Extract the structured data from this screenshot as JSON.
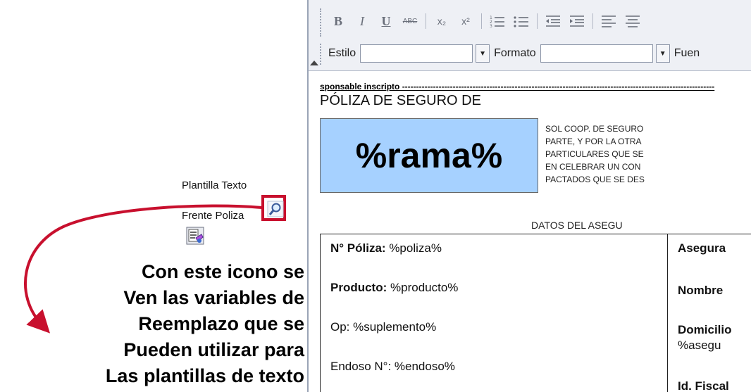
{
  "left_panel": {
    "plantilla_label": "Plantilla Texto",
    "frente_label": "Frente Poliza",
    "callout_lines": [
      "Con este icono se",
      "Ven las variables de",
      "Reemplazo que se",
      "Pueden utilizar para",
      "Las plantillas de texto"
    ]
  },
  "toolbar": {
    "bold": "B",
    "italic": "I",
    "underline": "U",
    "strike": "ABC",
    "subscript": "x₂",
    "superscript": "x²",
    "estilo_label": "Estilo",
    "formato_label": "Formato",
    "fuente_label": "Fuen",
    "estilo_value": "",
    "formato_value": ""
  },
  "document": {
    "cutline": "sponsable inscripto ---------------------------------------------------------------------------------------------------------------",
    "title": "PÓLIZA DE SEGURO DE",
    "rama": "%rama%",
    "legal_lines": [
      "SOL COOP. DE SEGURO",
      "PARTE, Y POR LA OTRA",
      "PARTICULARES QUE SE",
      "EN CELEBRAR UN CON",
      "PACTADOS QUE SE DES"
    ],
    "datos_header": "DATOS DEL ASEGU",
    "fields_left": [
      {
        "label": "N° Póliza:",
        "value": " %poliza%",
        "bold_label": true
      },
      {
        "label": "Producto:",
        "value": " %producto%",
        "bold_label": true
      },
      {
        "label": "Op:",
        "value": " %suplemento%",
        "bold_label": false
      },
      {
        "label": "Endoso N°:",
        "value": " %endoso%",
        "bold_label": false
      }
    ],
    "fields_right": [
      "Asegura",
      "Nombre",
      "Domicilio",
      "%asegu",
      "Id. Fiscal"
    ]
  },
  "colors": {
    "highlight_border": "#c8102e",
    "rama_box": "#a6d1ff",
    "arrow": "#c8102e"
  }
}
